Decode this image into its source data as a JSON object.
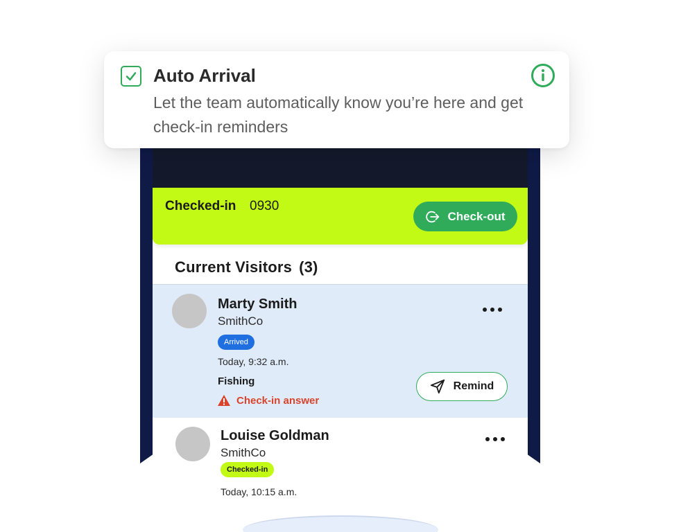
{
  "popup": {
    "title": "Auto Arrival",
    "description": "Let the team automatically know you’re here and get check-in reminders",
    "checked": true,
    "info_icon": "info-icon",
    "accent_color": "#2fab5a"
  },
  "checkin": {
    "label": "Checked-in",
    "time": "0930",
    "checkout_label": "Check-out",
    "checkout_icon": "logout-icon",
    "banner_color": "#c2f915"
  },
  "visitors": {
    "title": "Current Visitors",
    "count": "(3)",
    "items": [
      {
        "name": "Marty Smith",
        "company": "SmithCo",
        "status": "Arrived",
        "time": "Today, 9:32 a.m.",
        "activity": "Fishing",
        "alert": "Check-in answer",
        "remind_label": "Remind",
        "status_color": "#1f6fe0"
      },
      {
        "name": "Louise Goldman",
        "company": "SmithCo",
        "status": "Checked-in",
        "time": "Today, 10:15 a.m.",
        "status_color": "#c2f915"
      }
    ]
  }
}
